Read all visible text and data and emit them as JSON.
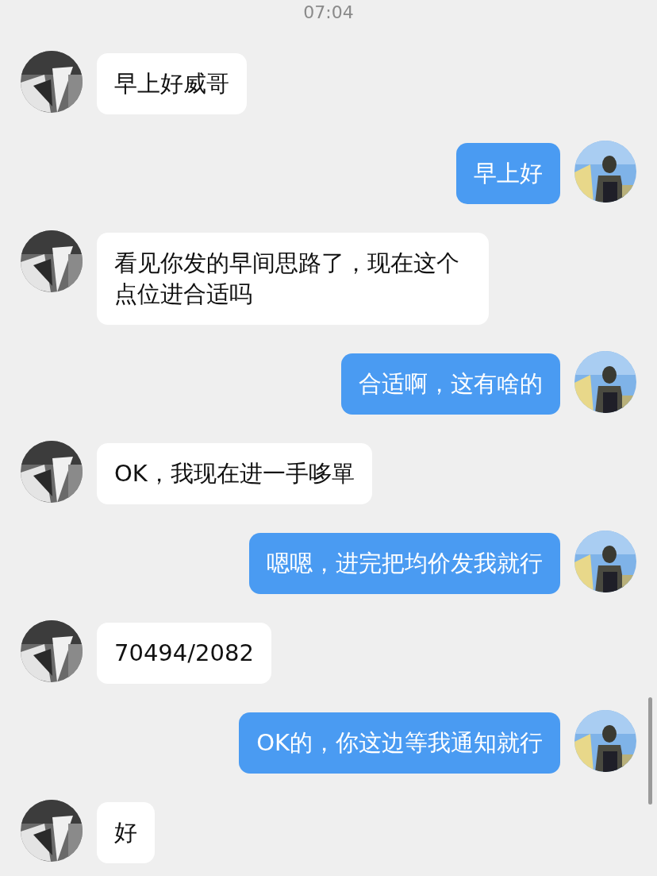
{
  "time": "07:04",
  "messages": [
    {
      "kind": "incoming",
      "text": "早上好威哥"
    },
    {
      "kind": "outgoing",
      "text": "早上好"
    },
    {
      "kind": "incoming",
      "text": "看见你发的早间思路了，现在这个点位进合适吗"
    },
    {
      "kind": "outgoing",
      "text": "合适啊，这有啥的"
    },
    {
      "kind": "incoming",
      "text": "OK，我现在进一手哆單"
    },
    {
      "kind": "outgoing",
      "text": "嗯嗯，进完把均价发我就行"
    },
    {
      "kind": "incoming",
      "text": "70494/2082"
    },
    {
      "kind": "outgoing",
      "text": "OK的，你这边等我通知就行"
    },
    {
      "kind": "incoming",
      "text": "好"
    }
  ]
}
